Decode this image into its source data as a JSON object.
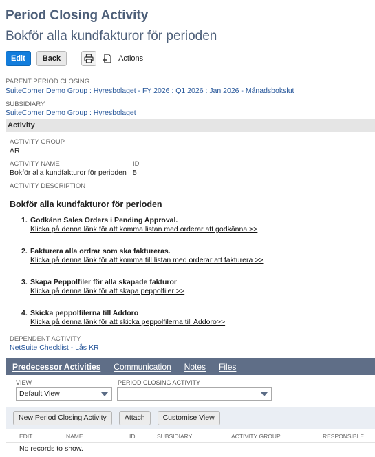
{
  "record": {
    "type_title": "Period Closing Activity",
    "name_title": "Bokför alla kundfakturor för perioden"
  },
  "toolbar": {
    "edit_label": "Edit",
    "back_label": "Back",
    "actions_label": "Actions"
  },
  "fields": {
    "parent_period_closing_label": "PARENT PERIOD CLOSING",
    "parent_period_closing_value": "SuiteCorner Demo Group : Hyresbolaget - FY 2026 : Q1 2026 : Jan 2026 - Månadsbokslut",
    "subsidiary_label": "SUBSIDIARY",
    "subsidiary_value": "SuiteCorner Demo Group : Hyresbolaget"
  },
  "activity_section": {
    "title": "Activity",
    "activity_group_label": "ACTIVITY GROUP",
    "activity_group_value": "AR",
    "activity_name_label": "ACTIVITY NAME",
    "activity_name_value": "Bokför alla kundfakturor för perioden",
    "id_label": "ID",
    "id_value": "5",
    "activity_description_label": "ACTIVITY DESCRIPTION",
    "description_title": "Bokför alla kundfakturor för perioden",
    "steps": [
      {
        "num": "1.",
        "title": "Godkänn Sales Orders i Pending Approval.",
        "link": "Klicka på denna länk för att komma listan med orderar att godkänna >>"
      },
      {
        "num": "2.",
        "title": "Fakturera alla ordrar som ska faktureras.",
        "link": "Klicka på denna länk för att komma till listan med orderar att fakturera >>"
      },
      {
        "num": "3.",
        "title": "Skapa Peppolfiler för alla skapade fakturor",
        "link": "Klicka på denna länk för att skapa peppolfiler >>"
      },
      {
        "num": "4.",
        "title": "Skicka peppolfilerna till Addoro",
        "link": "Klicka på denna länk för att skicka peppolfilerna  till Addoro>>"
      }
    ],
    "dependent_activity_label": "DEPENDENT ACTIVITY",
    "dependent_activity_value": "NetSuite Checklist - Lås KR"
  },
  "subtabs": [
    "Predecessor Activities",
    "Communication",
    "Notes",
    "Files"
  ],
  "sublist": {
    "view_label": "VIEW",
    "view_value": "Default View",
    "period_closing_activity_label": "PERIOD CLOSING ACTIVITY",
    "period_closing_activity_value": "",
    "buttons": [
      "New Period Closing Activity",
      "Attach",
      "Customise View"
    ],
    "columns": [
      "EDIT",
      "NAME",
      "ID",
      "SUBSIDIARY",
      "ACTIVITY GROUP",
      "RESPONSIBLE"
    ],
    "empty_message": "No records to show."
  },
  "colors": {
    "primary_button": "#127ddc",
    "title_text": "#4d5f79",
    "subtab_bar": "#5f6e87",
    "link": "#255599"
  }
}
